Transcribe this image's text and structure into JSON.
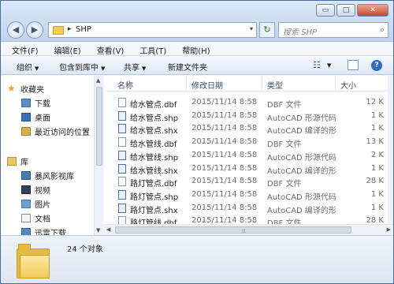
{
  "window": {
    "buttons": {
      "minimize": "▭",
      "maximize": "□",
      "close": "✕"
    }
  },
  "address": {
    "path": "SHP",
    "separator": "▸",
    "dropdown": "▾",
    "refresh": "↻"
  },
  "search": {
    "placeholder": "搜索 SHP",
    "icon": "search-icon"
  },
  "menu": [
    "文件(F)",
    "编辑(E)",
    "查看(V)",
    "工具(T)",
    "帮助(H)"
  ],
  "toolbar": {
    "organize": "组织",
    "include_in_library": "包含到库中",
    "share": "共享",
    "new_folder": "新建文件夹"
  },
  "navigation": {
    "favorites_header": "收藏夹",
    "favorites": [
      "下载",
      "桌面",
      "最近访问的位置"
    ],
    "libraries_header": "库",
    "libraries": [
      "暴风影视库",
      "视频",
      "图片",
      "文档",
      "迅雷下载"
    ]
  },
  "columns": {
    "name": "名称",
    "date": "修改日期",
    "type": "类型",
    "size": "大小"
  },
  "files": [
    {
      "name": "给水管点.dbf",
      "date": "2015/11/14 8:58",
      "type": "DBF 文件",
      "size": "12 K",
      "icon": "dbf"
    },
    {
      "name": "给水管点.shp",
      "date": "2015/11/14 8:58",
      "type": "AutoCAD 形源代码",
      "size": "1 K",
      "icon": "cad"
    },
    {
      "name": "给水管点.shx",
      "date": "2015/11/14 8:58",
      "type": "AutoCAD 编译的形",
      "size": "1 K",
      "icon": "cad"
    },
    {
      "name": "给水管线.dbf",
      "date": "2015/11/14 8:58",
      "type": "DBF 文件",
      "size": "13 K",
      "icon": "dbf"
    },
    {
      "name": "给水管线.shp",
      "date": "2015/11/14 8:58",
      "type": "AutoCAD 形源代码",
      "size": "2 K",
      "icon": "cad"
    },
    {
      "name": "给水管线.shx",
      "date": "2015/11/14 8:58",
      "type": "AutoCAD 编译的形",
      "size": "1 K",
      "icon": "cad"
    },
    {
      "name": "路灯管点.dbf",
      "date": "2015/11/14 8:58",
      "type": "DBF 文件",
      "size": "28 K",
      "icon": "dbf"
    },
    {
      "name": "路灯管点.shp",
      "date": "2015/11/14 8:58",
      "type": "AutoCAD 形源代码",
      "size": "1 K",
      "icon": "cad"
    },
    {
      "name": "路灯管点.shx",
      "date": "2015/11/14 8:58",
      "type": "AutoCAD 编译的形",
      "size": "1 K",
      "icon": "cad"
    },
    {
      "name": "路灯管线.dbf",
      "date": "2015/11/14 8:58",
      "type": "DBF 文件",
      "size": "28 K",
      "icon": "dbf"
    }
  ],
  "status": {
    "count": "24 个对象"
  }
}
